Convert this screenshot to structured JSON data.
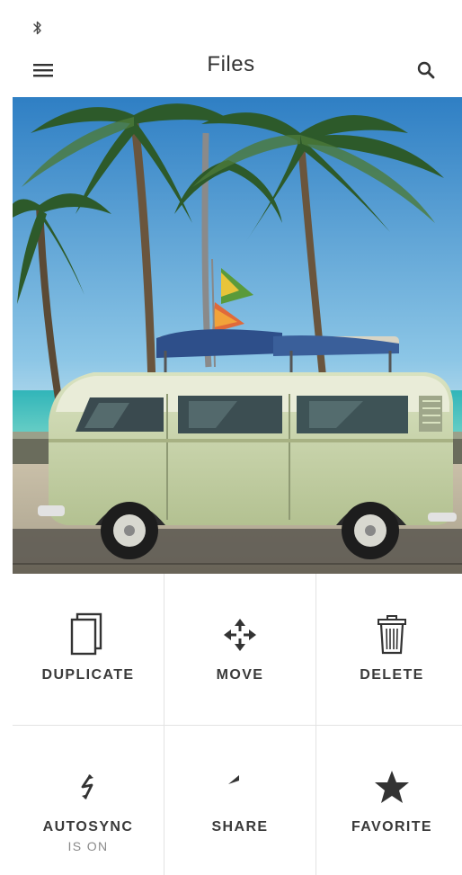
{
  "status_bar": {
    "bluetooth_icon": "bluetooth-icon"
  },
  "app_bar": {
    "title": "Files",
    "menu_icon": "hamburger-menu-icon",
    "search_icon": "search-icon"
  },
  "photo": {
    "subject": "vintage van under palm trees at the beach"
  },
  "actions": [
    {
      "label": "DUPLICATE",
      "icon": "duplicate-icon"
    },
    {
      "label": "MOVE",
      "icon": "move-icon"
    },
    {
      "label": "DELETE",
      "icon": "trash-icon"
    },
    {
      "label": "AUTOSYNC",
      "sublabel": "IS ON",
      "icon": "autosync-icon"
    },
    {
      "label": "SHARE",
      "icon": "share-icon"
    },
    {
      "label": "FAVORITE",
      "icon": "star-icon"
    }
  ],
  "colors": {
    "text": "#333333",
    "divider": "#e3e3e3",
    "icon": "#333333",
    "sublabel": "#8a8a8a"
  }
}
